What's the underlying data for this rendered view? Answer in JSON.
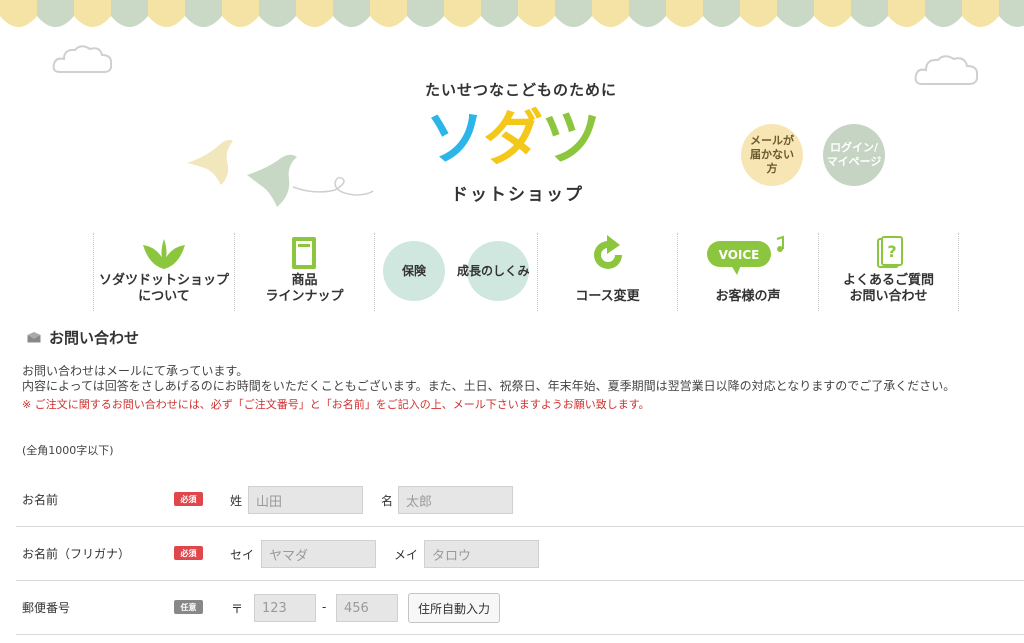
{
  "header": {
    "tagline": "たいせつなこどものために",
    "logo_chars": [
      "ソ",
      "ダ",
      "ツ"
    ],
    "logo_sub": "ドットショップ",
    "mail_button": "メールが\n届かない\n方",
    "login_button": "ログイン/\nマイページ"
  },
  "nav": {
    "items": [
      {
        "label": "ソダツドットショップ\nについて",
        "icon": "leaf-icon"
      },
      {
        "label": "商品\nラインナップ",
        "icon": "book-icon"
      },
      {
        "label_a": "保険",
        "label_b": "成長のしくみ",
        "icon": "blob-icon"
      },
      {
        "label": "コース変更",
        "icon": "refresh-icon"
      },
      {
        "label": "お客様の声",
        "icon": "voice-bubble-icon",
        "voice_text": "VOICE"
      },
      {
        "label": "よくあるご質問\nお問い合わせ",
        "icon": "question-note-icon"
      }
    ]
  },
  "section": {
    "title": "お問い合わせ",
    "intro_line1": "お問い合わせはメールにて承っています。",
    "intro_line2": "内容によっては回答をさしあげるのにお時間をいただくこともございます。また、土日、祝祭日、年末年始、夏季期間は翌営業日以降の対応となりますのでご了承ください。",
    "note": "※ ご注文に関するお問い合わせには、必ず「ご注文番号」と「お名前」をご記入の上、メール下さいますようお願い致します。",
    "limit": "(全角1000字以下)"
  },
  "form": {
    "name": {
      "label": "お名前",
      "badge": "必須",
      "last_label": "姓",
      "last_placeholder": "山田",
      "first_label": "名",
      "first_placeholder": "太郎"
    },
    "kana": {
      "label": "お名前（フリガナ）",
      "badge": "必須",
      "last_label": "セイ",
      "last_placeholder": "ヤマダ",
      "first_label": "メイ",
      "first_placeholder": "タロウ"
    },
    "zip": {
      "label": "郵便番号",
      "badge": "任意",
      "prefix": "〒",
      "part1_placeholder": "123",
      "dash": "-",
      "part2_placeholder": "456",
      "auto_button": "住所自動入力"
    }
  },
  "colors": {
    "logo_blue": "#2bb5e8",
    "logo_yellow": "#f4c81a",
    "logo_green": "#8cc63e",
    "required_red": "#e0474c",
    "note_red": "#d03030"
  }
}
